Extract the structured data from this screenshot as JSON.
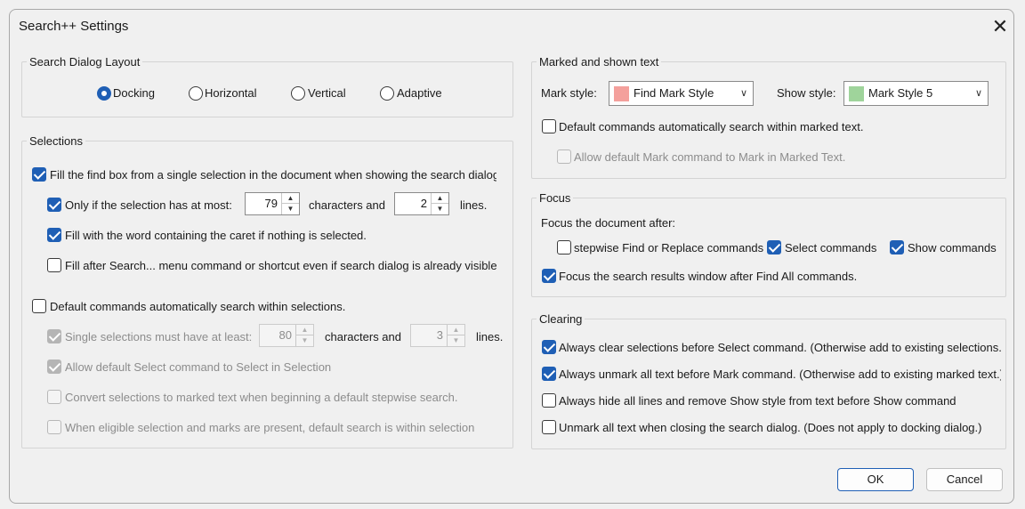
{
  "window": {
    "title": "Search++ Settings",
    "close_glyph": "✕"
  },
  "layout": {
    "label": "Search Dialog Layout",
    "options": [
      {
        "label": "Docking",
        "selected": true
      },
      {
        "label": "Horizontal",
        "selected": false
      },
      {
        "label": "Vertical",
        "selected": false
      },
      {
        "label": "Adaptive",
        "selected": false
      }
    ]
  },
  "selections": {
    "label": "Selections",
    "fill_find_box": {
      "label": "Fill the find box from a single selection in the document when showing the search dialog",
      "checked": true
    },
    "only_if": {
      "label": "Only if the selection has at most:",
      "checked": true,
      "chars_value": "79",
      "chars_label": "characters and",
      "lines_value": "2",
      "lines_label": "lines."
    },
    "fill_word": {
      "label": "Fill with the word containing the caret if nothing is selected.",
      "checked": true
    },
    "fill_after": {
      "label": "Fill after Search... menu command or shortcut even if search dialog is already visible",
      "checked": false
    },
    "default_within": {
      "label": "Default commands automatically search within selections.",
      "checked": false
    },
    "single_min": {
      "label": "Single selections must have at least:",
      "checked": true,
      "chars_value": "80",
      "chars_label": "characters and",
      "lines_value": "3",
      "lines_label": "lines."
    },
    "allow_select": {
      "label": "Allow default Select command to Select in Selection",
      "checked": true
    },
    "convert": {
      "label": "Convert selections to marked text when beginning a default stepwise search.",
      "checked": false
    },
    "eligible": {
      "label": "When eligible selection and marks are present, default search is within selection",
      "checked": false
    }
  },
  "marked": {
    "label": "Marked and shown text",
    "mark_style_label": "Mark style:",
    "mark_style_value": "Find Mark Style",
    "mark_color": "#f4a09c",
    "show_style_label": "Show style:",
    "show_style_value": "Mark Style 5",
    "show_color": "#9fd49b",
    "default_marked": {
      "label": "Default commands automatically search within marked text.",
      "checked": false
    },
    "allow_mark": {
      "label": "Allow default Mark command to Mark in Marked Text.",
      "checked": false
    }
  },
  "focus": {
    "label": "Focus",
    "after_label": "Focus the document after:",
    "stepwise": {
      "label": "stepwise Find or Replace commands",
      "checked": false
    },
    "select_cmds": {
      "label": "Select commands",
      "checked": true
    },
    "show_cmds": {
      "label": "Show commands",
      "checked": true
    },
    "results": {
      "label": "Focus the search results window after Find All commands.",
      "checked": true
    }
  },
  "clearing": {
    "label": "Clearing",
    "items": [
      {
        "label": "Always clear selections before Select command. (Otherwise add to existing selections.)",
        "checked": true
      },
      {
        "label": "Always unmark all text before Mark command. (Otherwise add to existing marked text.)",
        "checked": true
      },
      {
        "label": "Always hide all lines and remove Show style from text before Show command",
        "checked": false
      },
      {
        "label": "Unmark all text when closing the search dialog. (Does not apply to docking dialog.)",
        "checked": false
      }
    ]
  },
  "buttons": {
    "ok": "OK",
    "cancel": "Cancel"
  }
}
